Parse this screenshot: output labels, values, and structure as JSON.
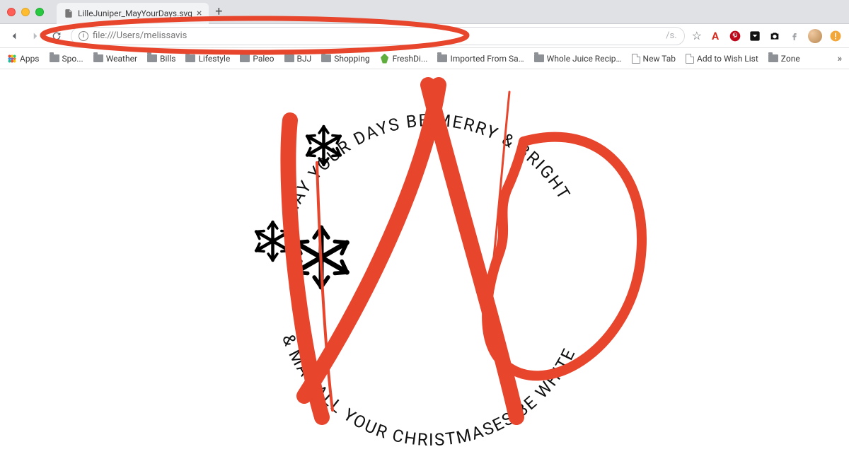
{
  "tab": {
    "title": "LilleJuniper_MayYourDays.svg"
  },
  "url": {
    "text": "file:///Users/melissavis",
    "suffix": "/s."
  },
  "bookmarks": {
    "apps_label": "Apps",
    "items": [
      {
        "label": "Spo...",
        "icon": "folder"
      },
      {
        "label": "Weather",
        "icon": "folder"
      },
      {
        "label": "Bills",
        "icon": "folder"
      },
      {
        "label": "Lifestyle",
        "icon": "folder"
      },
      {
        "label": "Paleo",
        "icon": "folder"
      },
      {
        "label": "BJJ",
        "icon": "folder"
      },
      {
        "label": "Shopping",
        "icon": "folder"
      },
      {
        "label": "FreshDi...",
        "icon": "leaf"
      },
      {
        "label": "Imported From Sa…",
        "icon": "folder"
      },
      {
        "label": "Whole Juice Recip…",
        "icon": "folder"
      },
      {
        "label": "New Tab",
        "icon": "page"
      },
      {
        "label": "Add to Wish List",
        "icon": "page"
      },
      {
        "label": "Zone",
        "icon": "folder"
      }
    ]
  },
  "svg": {
    "top_text": "MAY YOUR DAYS BE MERRY & BRIGHT",
    "bottom_text": "& MAY ALL YOUR CHRISTMASES BE WHITE"
  },
  "colors": {
    "annotation": "#e8452d"
  }
}
